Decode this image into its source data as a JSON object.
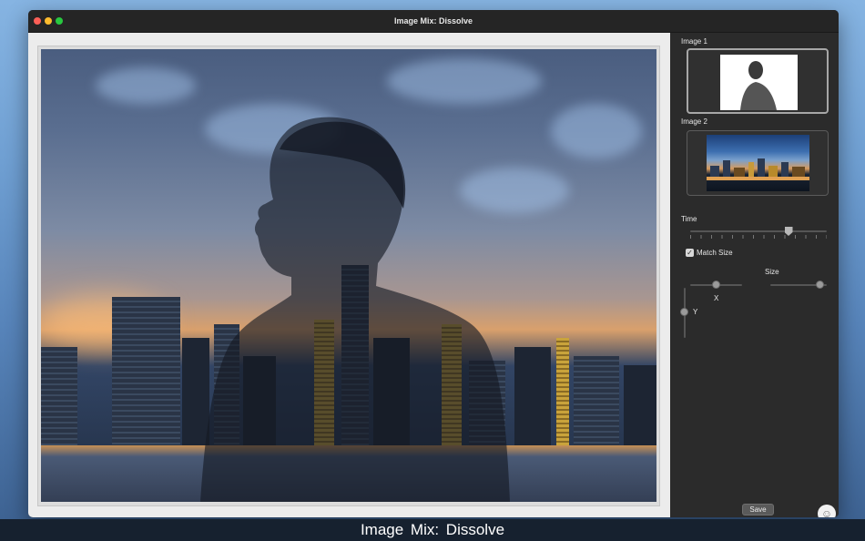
{
  "window": {
    "title": "Image Mix: Dissolve"
  },
  "sidebar": {
    "image1_label": "Image 1",
    "image2_label": "Image 2",
    "time_label": "Time",
    "time_value": 0.72,
    "match_size_label": "Match Size",
    "match_size_checked": true,
    "checkbox_glyph": "✓",
    "size_label": "Size",
    "x_label": "X",
    "y_label": "Y",
    "save_label": "Save",
    "smiley_glyph": "☺"
  },
  "caption": {
    "text": "Image Mix: Dissolve"
  },
  "icons": {
    "close": "close-icon",
    "minimize": "minimize-icon",
    "maximize": "maximize-icon",
    "checkbox": "checkmark-icon",
    "feedback": "smiley-icon"
  },
  "colors": {
    "close": "#fc5f57",
    "minimize": "#fdbc2e",
    "maximize": "#28c840",
    "sidebar_bg": "#2b2b2b",
    "canvas_bg": "#ececec"
  }
}
